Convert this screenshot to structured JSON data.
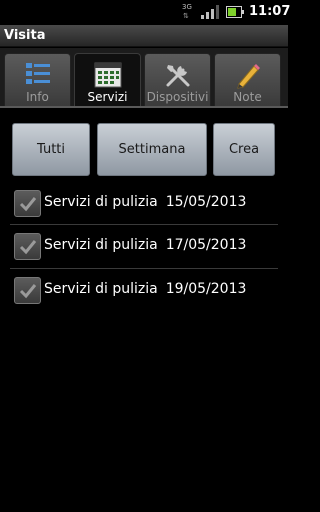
{
  "status_bar": {
    "network_label": "3G",
    "time": "11:07",
    "battery_level": 0.65,
    "signal_level": 0.75
  },
  "app": {
    "title": "Visita"
  },
  "tabs": [
    {
      "label": "Info",
      "icon": "list-icon",
      "active": false
    },
    {
      "label": "Servizi",
      "icon": "calendar-icon",
      "active": true
    },
    {
      "label": "Dispositivi",
      "icon": "tools-icon",
      "active": false
    },
    {
      "label": "Note",
      "icon": "pencil-icon",
      "active": false
    }
  ],
  "actions": {
    "all_label": "Tutti",
    "week_label": "Settimana",
    "create_label": "Crea"
  },
  "services": [
    {
      "name": "Servizi di pulizia",
      "date": "15/05/2013",
      "checked": true
    },
    {
      "name": "Servizi di pulizia",
      "date": "17/05/2013",
      "checked": true
    },
    {
      "name": "Servizi di pulizia",
      "date": "19/05/2013",
      "checked": true
    }
  ]
}
